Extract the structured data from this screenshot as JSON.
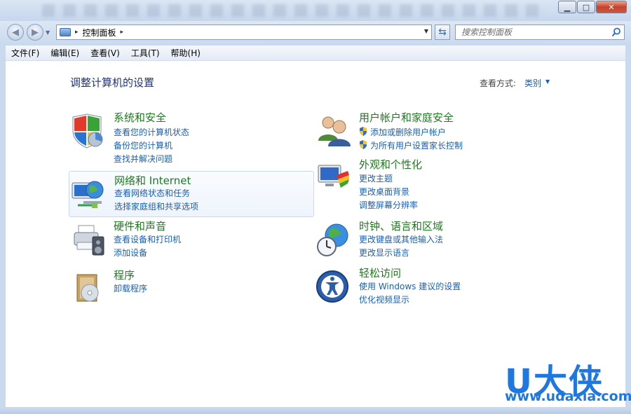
{
  "window": {
    "minimize_glyph": "▁",
    "maximize_glyph": "□",
    "close_glyph": "✕"
  },
  "nav": {
    "back_glyph": "◀",
    "forward_glyph": "▶",
    "address_separator": "▸",
    "breadcrumb": "控制面板",
    "search_placeholder": "搜索控制面板"
  },
  "menu": [
    "文件(F)",
    "编辑(E)",
    "查看(V)",
    "工具(T)",
    "帮助(H)"
  ],
  "header": {
    "title": "调整计算机的设置",
    "view_by_label": "查看方式:",
    "view_by_value": "类别"
  },
  "categories": {
    "system_security": {
      "title": "系统和安全",
      "links": [
        "查看您的计算机状态",
        "备份您的计算机",
        "查找并解决问题"
      ]
    },
    "network": {
      "title": "网络和 Internet",
      "links": [
        "查看网络状态和任务",
        "选择家庭组和共享选项"
      ]
    },
    "hardware": {
      "title": "硬件和声音",
      "links": [
        "查看设备和打印机",
        "添加设备"
      ]
    },
    "programs": {
      "title": "程序",
      "links": [
        "卸载程序"
      ]
    },
    "user_accounts": {
      "title": "用户帐户和家庭安全",
      "links": [
        "添加或删除用户帐户",
        "为所有用户设置家长控制"
      ]
    },
    "appearance": {
      "title": "外观和个性化",
      "links": [
        "更改主题",
        "更改桌面背景",
        "调整屏幕分辨率"
      ]
    },
    "clock_region": {
      "title": "时钟、语言和区域",
      "links": [
        "更改键盘或其他输入法",
        "更改显示语言"
      ]
    },
    "ease_access": {
      "title": "轻松访问",
      "links": [
        "使用 Windows 建议的设置",
        "优化视频显示"
      ]
    }
  },
  "watermark": {
    "logo": "U大侠",
    "url": "www.udaxia.com"
  },
  "colors": {
    "title_green": "#1f7a1f",
    "link_blue": "#1a5fb4",
    "heading_navy": "#1e3287",
    "watermark_blue": "#1f78e0"
  }
}
